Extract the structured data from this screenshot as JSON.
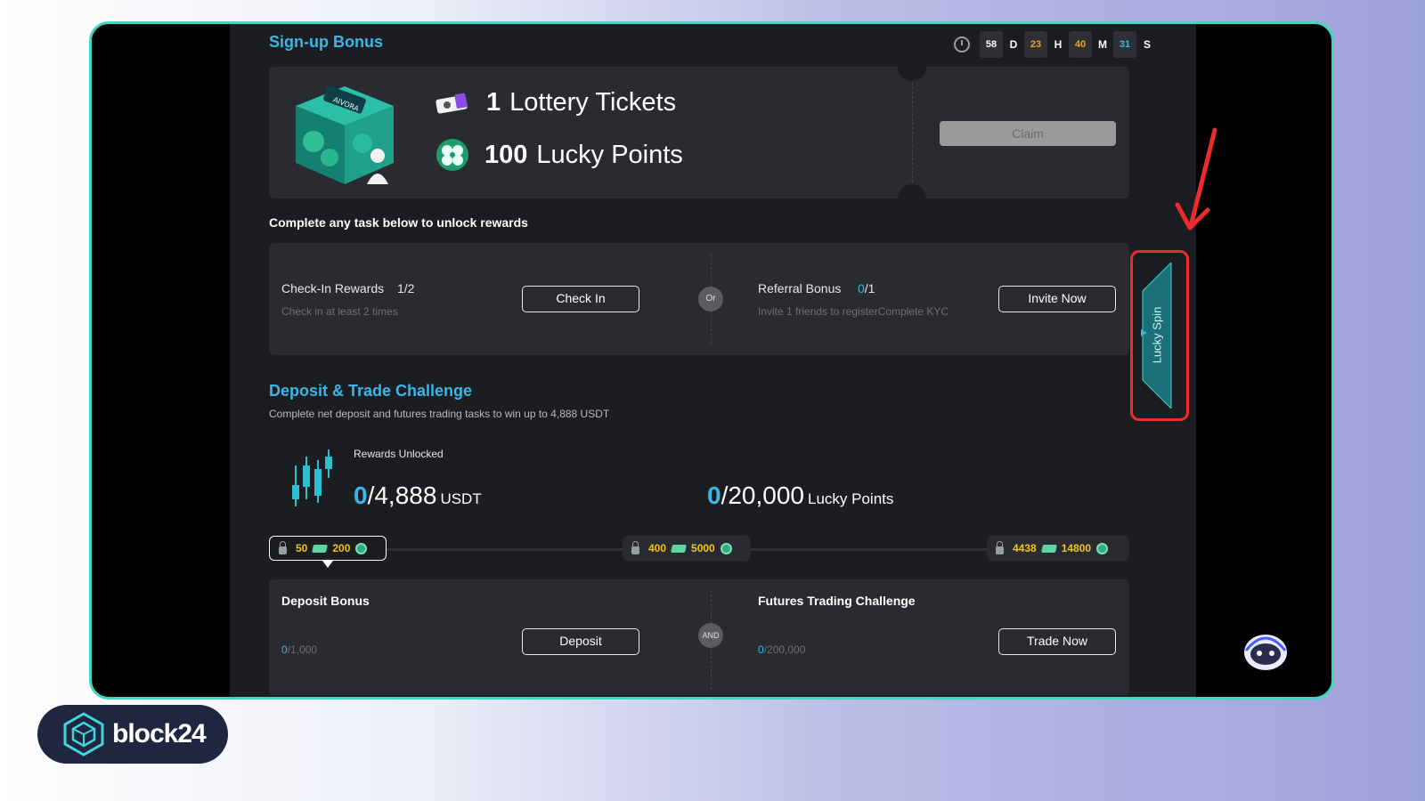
{
  "signup": {
    "title": "Sign-up Bonus",
    "timer": {
      "days": "58",
      "days_unit": "D",
      "hours": "23",
      "hours_unit": "H",
      "minutes": "40",
      "minutes_unit": "M",
      "seconds": "31",
      "seconds_unit": "S"
    },
    "box_logo": "AIVORA",
    "tickets_count": "1",
    "tickets_label": "Lottery Tickets",
    "points_count": "100",
    "points_label": "Lucky Points",
    "claim_label": "Claim"
  },
  "tasks": {
    "heading": "Complete any task below to unlock rewards",
    "checkin": {
      "title": "Check-In Rewards",
      "progress": "1/2",
      "sub": "Check in at least 2 times",
      "button": "Check In"
    },
    "or_label": "Or",
    "referral": {
      "title": "Referral Bonus",
      "progress_current": "0",
      "progress_total": "/1",
      "sub": "Invite 1 friends to registerComplete KYC",
      "button": "Invite Now"
    }
  },
  "challenge": {
    "title": "Deposit & Trade Challenge",
    "sub": "Complete net deposit and futures trading tasks to win up to 4,888 USDT",
    "rewards_label": "Rewards Unlocked",
    "usdt_current": "0",
    "usdt_total": "/4,888",
    "usdt_unit": "USDT",
    "points_current": "0",
    "points_total": "/20,000",
    "points_unit": "Lucky Points",
    "milestones": [
      {
        "a": "50",
        "b": "200"
      },
      {
        "a": "400",
        "b": "5000"
      },
      {
        "a": "4438",
        "b": "14800"
      }
    ],
    "deposit": {
      "title": "Deposit Bonus",
      "current": "0",
      "total": "/1,000",
      "button": "Deposit",
      "progress": 0
    },
    "and_label": "AND",
    "futures": {
      "title": "Futures Trading Challenge",
      "current": "0",
      "total": "/200,000",
      "button": "Trade Now",
      "progress": 0
    }
  },
  "lucky_spin": {
    "label": "Lucky Spin"
  },
  "brand": {
    "name": "block24"
  },
  "colors": {
    "accent": "#3ab6e8",
    "gold": "#f0c419",
    "frame": "#3fd6c2",
    "highlight": "#ea2c2c"
  }
}
